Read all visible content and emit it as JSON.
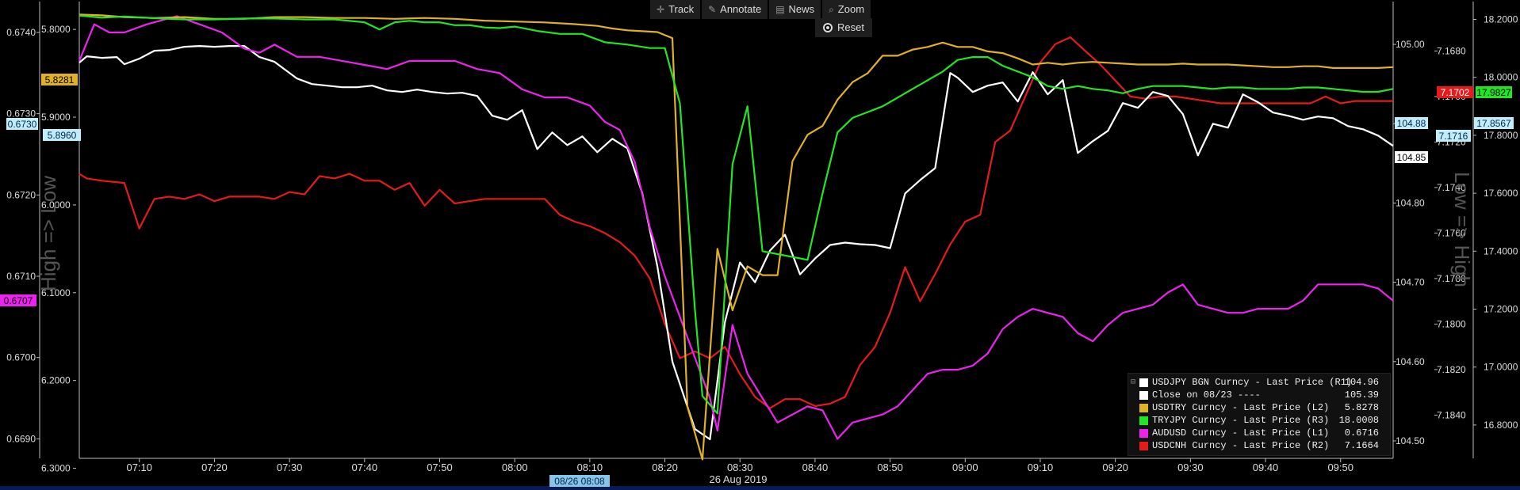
{
  "toolbar": {
    "track": "Track",
    "annotate": "Annotate",
    "news": "News",
    "zoom": "Zoom",
    "reset": "Reset"
  },
  "colors": {
    "usdjpy": "#ffffff",
    "usdtry": "#e0b025",
    "tryjpy": "#22e622",
    "audusd": "#ee22ee",
    "usdcnh": "#e51b1b"
  },
  "axes": {
    "date_label": "26 Aug 2019",
    "crosshair_label": "08/26 08:08",
    "left_title": "High => Low",
    "right_title": "Low => High",
    "x_ticks": [
      "07:10",
      "07:20",
      "07:30",
      "07:40",
      "07:50",
      "08:00",
      "08:10",
      "08:20",
      "08:30",
      "08:40",
      "08:50",
      "09:00",
      "09:10",
      "09:20",
      "09:30",
      "09:40",
      "09:50"
    ],
    "L1_ticks": [
      "0.6740",
      "0.6730",
      "0.6720",
      "0.6710",
      "0.6700",
      "0.6690"
    ],
    "L1_range": [
      0.66876,
      0.67436
    ],
    "L2_ticks": [
      "5.8000",
      "5.9000",
      "6.0000",
      "6.1000",
      "6.2000",
      "6.3000"
    ],
    "L2_range": [
      5.7701,
      6.2887
    ],
    "R1_ticks": [
      "105.00",
      "104.90",
      "104.80",
      "104.70",
      "104.60",
      "104.50"
    ],
    "R1_range": [
      104.478,
      105.052
    ],
    "R2_ticks": [
      "7.1680",
      "7.1700",
      "7.1720",
      "7.1740",
      "7.1760",
      "7.1780",
      "7.1800",
      "7.1820",
      "7.1840"
    ],
    "R2_range": [
      7.1659,
      7.1859
    ],
    "R3_ticks": [
      "18.2000",
      "18.0000",
      "17.8000",
      "17.6000",
      "17.4000",
      "17.2000",
      "17.0000",
      "16.8000"
    ],
    "R3_range": [
      16.685,
      18.256
    ]
  },
  "value_tags": {
    "L2_left": "5.8281",
    "L1_crosshair": "0.6730",
    "L2_crosshair": "5.8960",
    "L1_left": "0.6707",
    "R2_last": "7.1702",
    "R3_last": "17.9827",
    "R1_crosshair": "104.88",
    "R2_crosshair": "7.1716",
    "R3_crosshair": "17.8567",
    "R1_last": "104.85"
  },
  "legend": [
    {
      "key": "usdjpy",
      "label": "USDJPY BGN Curncy - Last Price (R1)",
      "value": "104.96"
    },
    {
      "key": "close",
      "label": "Close on 08/23 ----",
      "value": "105.39"
    },
    {
      "key": "usdtry",
      "label": "USDTRY Curncy - Last Price (L2)",
      "value": "5.8278"
    },
    {
      "key": "tryjpy",
      "label": "TRYJPY Curncy - Last Price (R3)",
      "value": "18.0008"
    },
    {
      "key": "audusd",
      "label": "AUDUSD Curncy - Last Price (L1)",
      "value": "0.6716"
    },
    {
      "key": "usdcnh",
      "label": "USDCNH Curncy - Last Price (R2)",
      "value": "7.1664"
    }
  ],
  "chart_data": {
    "type": "line",
    "title": "",
    "xlabel": "26 Aug 2019",
    "time_range": [
      "07:02",
      "09:57"
    ],
    "grid": false,
    "legend_position": "bottom-right",
    "series": [
      {
        "name": "USDJPY BGN Curncy - Last Price (R1)",
        "color_key": "usdjpy",
        "axis": "R1",
        "inverted": false,
        "t": [
          "07:02",
          "07:03",
          "07:04",
          "07:05",
          "07:07",
          "07:08",
          "07:10",
          "07:12",
          "07:14",
          "07:16",
          "07:18",
          "07:20",
          "07:22",
          "07:24",
          "07:26",
          "07:28",
          "07:31",
          "07:33",
          "07:35",
          "07:37",
          "07:39",
          "07:41",
          "07:43",
          "07:45",
          "07:47",
          "07:49",
          "07:51",
          "07:53",
          "07:55",
          "07:57",
          "07:59",
          "08:01",
          "08:03",
          "08:05",
          "08:07",
          "08:09",
          "08:11",
          "08:13",
          "08:15",
          "08:17",
          "08:19",
          "08:21",
          "08:24",
          "08:26",
          "08:28",
          "08:30",
          "08:32",
          "08:34",
          "08:36",
          "08:38",
          "08:40",
          "08:42",
          "08:44",
          "08:46",
          "08:48",
          "08:50",
          "08:52",
          "08:54",
          "08:56",
          "08:58",
          "08:59",
          "09:01",
          "09:03",
          "09:05",
          "09:07",
          "09:09",
          "09:11",
          "09:13",
          "09:15",
          "09:17",
          "09:19",
          "09:21",
          "09:23",
          "09:25",
          "09:27",
          "09:29",
          "09:31",
          "09:33",
          "09:35",
          "09:37",
          "09:39",
          "09:41",
          "09:43",
          "09:45",
          "09:47",
          "09:49",
          "09:51",
          "09:53",
          "09:55",
          "09:57"
        ],
        "values": [
          104.977,
          104.985,
          104.984,
          104.983,
          104.984,
          104.975,
          104.982,
          104.992,
          104.993,
          104.997,
          104.998,
          104.997,
          104.998,
          104.998,
          104.984,
          104.978,
          104.957,
          104.95,
          104.948,
          104.946,
          104.946,
          104.948,
          104.942,
          104.94,
          104.943,
          104.94,
          104.938,
          104.939,
          104.935,
          104.91,
          104.905,
          104.917,
          104.868,
          104.889,
          104.873,
          104.884,
          104.864,
          104.881,
          104.869,
          104.812,
          104.72,
          104.6,
          104.515,
          104.502,
          104.65,
          104.725,
          104.7,
          104.74,
          104.76,
          104.71,
          104.73,
          104.747,
          104.75,
          104.748,
          104.747,
          104.743,
          104.812,
          104.829,
          104.844,
          104.964,
          104.958,
          104.94,
          104.948,
          104.952,
          104.928,
          104.965,
          104.937,
          104.955,
          104.863,
          104.878,
          104.891,
          104.926,
          104.92,
          104.94,
          104.935,
          104.912,
          104.86,
          104.9,
          104.895,
          104.937,
          104.927,
          104.914,
          104.91,
          104.905,
          104.909,
          104.907,
          104.897,
          104.893,
          104.885,
          104.872
        ]
      },
      {
        "name": "USDTRY Curncy - Last Price (L2)",
        "color_key": "usdtry",
        "axis": "L2",
        "inverted": true,
        "t": [
          "07:02",
          "07:05",
          "07:08",
          "07:12",
          "07:16",
          "07:20",
          "07:24",
          "07:28",
          "07:32",
          "07:36",
          "07:40",
          "07:44",
          "07:48",
          "07:52",
          "07:56",
          "08:00",
          "08:04",
          "08:08",
          "08:11",
          "08:13",
          "08:15",
          "08:17",
          "08:19",
          "08:21",
          "08:23",
          "08:25",
          "08:27",
          "08:29",
          "08:31",
          "08:33",
          "08:35",
          "08:37",
          "08:39",
          "08:41",
          "08:43",
          "08:45",
          "08:47",
          "08:49",
          "08:51",
          "08:53",
          "08:55",
          "08:57",
          "08:59",
          "09:01",
          "09:03",
          "09:05",
          "09:07",
          "09:09",
          "09:11",
          "09:13",
          "09:15",
          "09:17",
          "09:19",
          "09:21",
          "09:23",
          "09:25",
          "09:27",
          "09:29",
          "09:31",
          "09:33",
          "09:35",
          "09:37",
          "09:39",
          "09:41",
          "09:43",
          "09:45",
          "09:47",
          "09:49",
          "09:51",
          "09:53",
          "09:55",
          "09:57"
        ],
        "values": [
          5.783,
          5.784,
          5.786,
          5.787,
          5.786,
          5.788,
          5.788,
          5.786,
          5.786,
          5.787,
          5.787,
          5.788,
          5.787,
          5.788,
          5.79,
          5.791,
          5.792,
          5.794,
          5.796,
          5.799,
          5.801,
          5.802,
          5.803,
          5.81,
          6.23,
          6.29,
          6.05,
          6.12,
          6.07,
          6.08,
          6.08,
          5.95,
          5.92,
          5.91,
          5.88,
          5.86,
          5.85,
          5.83,
          5.83,
          5.823,
          5.82,
          5.815,
          5.82,
          5.82,
          5.825,
          5.827,
          5.833,
          5.84,
          5.838,
          5.84,
          5.838,
          5.837,
          5.838,
          5.839,
          5.84,
          5.84,
          5.84,
          5.839,
          5.84,
          5.84,
          5.84,
          5.841,
          5.842,
          5.843,
          5.843,
          5.842,
          5.842,
          5.844,
          5.844,
          5.844,
          5.844,
          5.843
        ]
      },
      {
        "name": "TRYJPY Curncy - Last Price (R3)",
        "color_key": "tryjpy",
        "axis": "R3",
        "inverted": false,
        "t": [
          "07:02",
          "07:05",
          "07:08",
          "07:12",
          "07:16",
          "07:20",
          "07:24",
          "07:28",
          "07:32",
          "07:36",
          "07:40",
          "07:42",
          "07:44",
          "07:46",
          "07:48",
          "07:50",
          "07:52",
          "07:54",
          "07:56",
          "07:58",
          "08:00",
          "08:03",
          "08:06",
          "08:09",
          "08:12",
          "08:15",
          "08:18",
          "08:20",
          "08:22",
          "08:24",
          "08:25",
          "08:27",
          "08:29",
          "08:31",
          "08:33",
          "08:35",
          "08:37",
          "08:39",
          "08:41",
          "08:43",
          "08:45",
          "08:47",
          "08:49",
          "08:51",
          "08:53",
          "08:55",
          "08:57",
          "08:59",
          "09:01",
          "09:03",
          "09:05",
          "09:07",
          "09:09",
          "09:11",
          "09:13",
          "09:15",
          "09:17",
          "09:19",
          "09:21",
          "09:23",
          "09:25",
          "09:27",
          "09:29",
          "09:31",
          "09:33",
          "09:35",
          "09:37",
          "09:39",
          "09:41",
          "09:43",
          "09:45",
          "09:47",
          "09:49",
          "09:51",
          "09:53",
          "09:55",
          "09:57"
        ],
        "values": [
          18.213,
          18.206,
          18.21,
          18.204,
          18.2,
          18.2,
          18.203,
          18.203,
          18.2,
          18.2,
          18.19,
          18.165,
          18.19,
          18.195,
          18.19,
          18.19,
          18.18,
          18.18,
          18.172,
          18.17,
          18.175,
          18.16,
          18.15,
          18.15,
          18.121,
          18.113,
          18.101,
          18.101,
          17.91,
          17.2,
          16.9,
          16.84,
          17.7,
          17.9,
          17.4,
          17.39,
          17.38,
          17.37,
          17.6,
          17.81,
          17.86,
          17.88,
          17.9,
          17.93,
          17.96,
          17.99,
          18.02,
          18.06,
          18.07,
          18.07,
          18.04,
          18.02,
          18.0,
          17.97,
          17.96,
          17.97,
          17.96,
          17.955,
          17.945,
          17.96,
          17.97,
          17.97,
          17.97,
          17.965,
          17.96,
          17.965,
          17.965,
          17.96,
          17.96,
          17.96,
          17.965,
          17.965,
          17.96,
          17.955,
          17.95,
          17.95,
          17.96
        ]
      },
      {
        "name": "AUDUSD Curncy - Last Price (L1)",
        "color_key": "audusd",
        "axis": "L1",
        "inverted": false,
        "t": [
          "07:02",
          "07:04",
          "07:06",
          "07:08",
          "07:11",
          "07:15",
          "07:18",
          "07:21",
          "07:24",
          "07:26",
          "07:28",
          "07:31",
          "07:34",
          "07:37",
          "07:40",
          "07:43",
          "07:46",
          "07:49",
          "07:52",
          "07:55",
          "07:58",
          "08:01",
          "08:04",
          "08:07",
          "08:10",
          "08:12",
          "08:14",
          "08:16",
          "08:18",
          "08:20",
          "08:22",
          "08:24",
          "08:26",
          "08:27",
          "08:29",
          "08:31",
          "08:33",
          "08:35",
          "08:37",
          "08:39",
          "08:41",
          "08:43",
          "08:45",
          "08:47",
          "08:49",
          "08:51",
          "08:53",
          "08:55",
          "08:57",
          "08:59",
          "09:01",
          "09:03",
          "09:05",
          "09:07",
          "09:09",
          "09:11",
          "09:13",
          "09:15",
          "09:17",
          "09:19",
          "09:21",
          "09:23",
          "09:25",
          "09:27",
          "09:29",
          "09:31",
          "09:33",
          "09:35",
          "09:37",
          "09:39",
          "09:41",
          "09:43",
          "09:45",
          "09:47",
          "09:49",
          "09:51",
          "09:53",
          "09:55",
          "09:57"
        ],
        "values": [
          0.67365,
          0.6741,
          0.674,
          0.674,
          0.6741,
          0.6742,
          0.6741,
          0.674,
          0.6738,
          0.67375,
          0.67385,
          0.6737,
          0.6737,
          0.67365,
          0.6736,
          0.67355,
          0.67365,
          0.67365,
          0.67365,
          0.67355,
          0.6735,
          0.6733,
          0.6732,
          0.6732,
          0.6731,
          0.6729,
          0.6728,
          0.6724,
          0.6716,
          0.671,
          0.6705,
          0.67,
          0.6695,
          0.6691,
          0.6704,
          0.6698,
          0.6695,
          0.6692,
          0.6693,
          0.6694,
          0.66935,
          0.669,
          0.6692,
          0.66925,
          0.6693,
          0.6694,
          0.6696,
          0.6698,
          0.66985,
          0.66985,
          0.6699,
          0.67005,
          0.67035,
          0.6705,
          0.6706,
          0.67055,
          0.6705,
          0.6703,
          0.6702,
          0.6704,
          0.67055,
          0.6706,
          0.67065,
          0.6708,
          0.6709,
          0.67065,
          0.6706,
          0.67055,
          0.67055,
          0.6706,
          0.6706,
          0.6706,
          0.6707,
          0.6709,
          0.6709,
          0.6709,
          0.6709,
          0.67085,
          0.6707
        ]
      },
      {
        "name": "USDCNH Curncy - Last Price (R2)",
        "color_key": "usdcnh",
        "axis": "R2",
        "inverted": true,
        "t": [
          "07:02",
          "07:03",
          "07:05",
          "07:08",
          "07:10",
          "07:12",
          "07:14",
          "07:16",
          "07:18",
          "07:20",
          "07:22",
          "07:24",
          "07:26",
          "07:28",
          "07:30",
          "07:32",
          "07:34",
          "07:36",
          "07:38",
          "07:40",
          "07:42",
          "07:44",
          "07:46",
          "07:48",
          "07:50",
          "07:52",
          "07:54",
          "07:56",
          "07:58",
          "08:00",
          "08:02",
          "08:04",
          "08:06",
          "08:08",
          "08:10",
          "08:12",
          "08:14",
          "08:16",
          "08:18",
          "08:20",
          "08:22",
          "08:24",
          "08:26",
          "08:28",
          "08:30",
          "08:32",
          "08:34",
          "08:36",
          "08:38",
          "08:40",
          "08:42",
          "08:44",
          "08:46",
          "08:48",
          "08:50",
          "08:52",
          "08:54",
          "08:56",
          "08:58",
          "09:00",
          "09:02",
          "09:04",
          "09:06",
          "09:08",
          "09:10",
          "09:12",
          "09:14",
          "09:16",
          "09:18",
          "09:20",
          "09:22",
          "09:24",
          "09:26",
          "09:28",
          "09:30",
          "09:32",
          "09:34",
          "09:36",
          "09:38",
          "09:40",
          "09:42",
          "09:44",
          "09:46",
          "09:48",
          "09:50",
          "09:52",
          "09:54",
          "09:56",
          "09:57"
        ],
        "values": [
          7.1734,
          7.1736,
          7.1737,
          7.1738,
          7.1758,
          7.1745,
          7.1744,
          7.1745,
          7.1743,
          7.1746,
          7.1744,
          7.1744,
          7.1744,
          7.1745,
          7.1742,
          7.1743,
          7.1735,
          7.1736,
          7.1734,
          7.1737,
          7.1737,
          7.1741,
          7.1738,
          7.1748,
          7.1741,
          7.1747,
          7.1746,
          7.1745,
          7.1745,
          7.1745,
          7.1745,
          7.1745,
          7.1752,
          7.1755,
          7.1757,
          7.176,
          7.1764,
          7.177,
          7.178,
          7.18,
          7.1815,
          7.1812,
          7.1815,
          7.181,
          7.1822,
          7.1832,
          7.1837,
          7.1833,
          7.1833,
          7.1836,
          7.1835,
          7.1832,
          7.1818,
          7.181,
          7.1795,
          7.1775,
          7.179,
          7.1778,
          7.1765,
          7.1755,
          7.1752,
          7.172,
          7.1715,
          7.17,
          7.1685,
          7.1677,
          7.1674,
          7.168,
          7.1686,
          7.1693,
          7.17,
          7.1701,
          7.17,
          7.17,
          7.1701,
          7.1702,
          7.1703,
          7.1703,
          7.1703,
          7.1703,
          7.1703,
          7.1703,
          7.1703,
          7.17,
          7.1703,
          7.1702,
          7.1702,
          7.1702,
          7.1702
        ]
      }
    ]
  }
}
